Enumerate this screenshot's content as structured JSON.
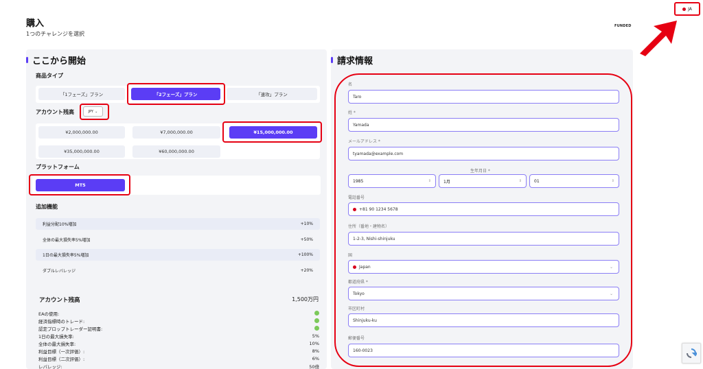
{
  "header": {
    "title": "購入",
    "subtitle": "1つのチャレンジを選択",
    "brand": "FUNDED"
  },
  "language": {
    "label": "JA"
  },
  "left": {
    "section_title": "ここから開始",
    "product_type_label": "商品タイプ",
    "plans": [
      "「1フェーズ」プラン",
      "「2フェーズ」プラン",
      "「速攻」プラン"
    ],
    "selected_plan": "「2フェーズ」プラン",
    "account_size_label": "アカウント残高",
    "currency": "JPY",
    "sizes": [
      "¥2,000,000.00",
      "¥7,000,000.00",
      "¥15,000,000.00",
      "¥35,000,000.00",
      "¥60,000,000.00"
    ],
    "selected_size": "¥15,000,000.00",
    "platform_label": "プラットフォーム",
    "platform": "MT5",
    "addons_label": "追加機能",
    "addons": [
      {
        "name": "利益分配10%増加",
        "value": "+10%"
      },
      {
        "name": "全体の最大損失率5%増加",
        "value": "+50%"
      },
      {
        "name": "1日の最大損失率5%増加",
        "value": "+100%"
      },
      {
        "name": "ダブルレバレッジ",
        "value": "+20%"
      }
    ],
    "summary": {
      "title": "アカウント残高",
      "value": "1,500万円",
      "specs": [
        {
          "label": "EAの使用:",
          "value": ""
        },
        {
          "label": "経済指標時のトレード:",
          "value": ""
        },
        {
          "label": "認定プロップトレーダー証明書:",
          "value": ""
        },
        {
          "label": "1日の最大損失率:",
          "value": "5%"
        },
        {
          "label": "全体の最大損失率:",
          "value": "10%"
        },
        {
          "label": "利益目標（一次評価）:",
          "value": "8%"
        },
        {
          "label": "利益目標（二次評価）:",
          "value": "6%"
        },
        {
          "label": "レバレッジ:",
          "value": "50倍"
        }
      ]
    }
  },
  "right": {
    "section_title": "請求情報",
    "first_name_label": "名",
    "first_name": "Taro",
    "last_name_label": "姓 *",
    "last_name": "Yamada",
    "email_label": "メールアドレス *",
    "email": "tyamada@example.com",
    "dob_label": "生年月日 *",
    "dob_year": "1985",
    "dob_month": "1月",
    "dob_day": "01",
    "phone_label": "電話番号",
    "phone": "+81 90 1234 5678",
    "address_label": "住所（番地・建物名）",
    "address": "1-2-3, Nishi-shinjuku",
    "country_label": "国",
    "country": "Japan",
    "prefecture_label": "都道府県 *",
    "prefecture": "Tokyo",
    "city_label": "市区町村",
    "city": "Shinjuku-ku",
    "postal_label": "郵便番号",
    "postal": "160-0023"
  },
  "colors": {
    "accent": "#5b3df5",
    "highlight": "#e60012",
    "check": "#7cc95a"
  }
}
